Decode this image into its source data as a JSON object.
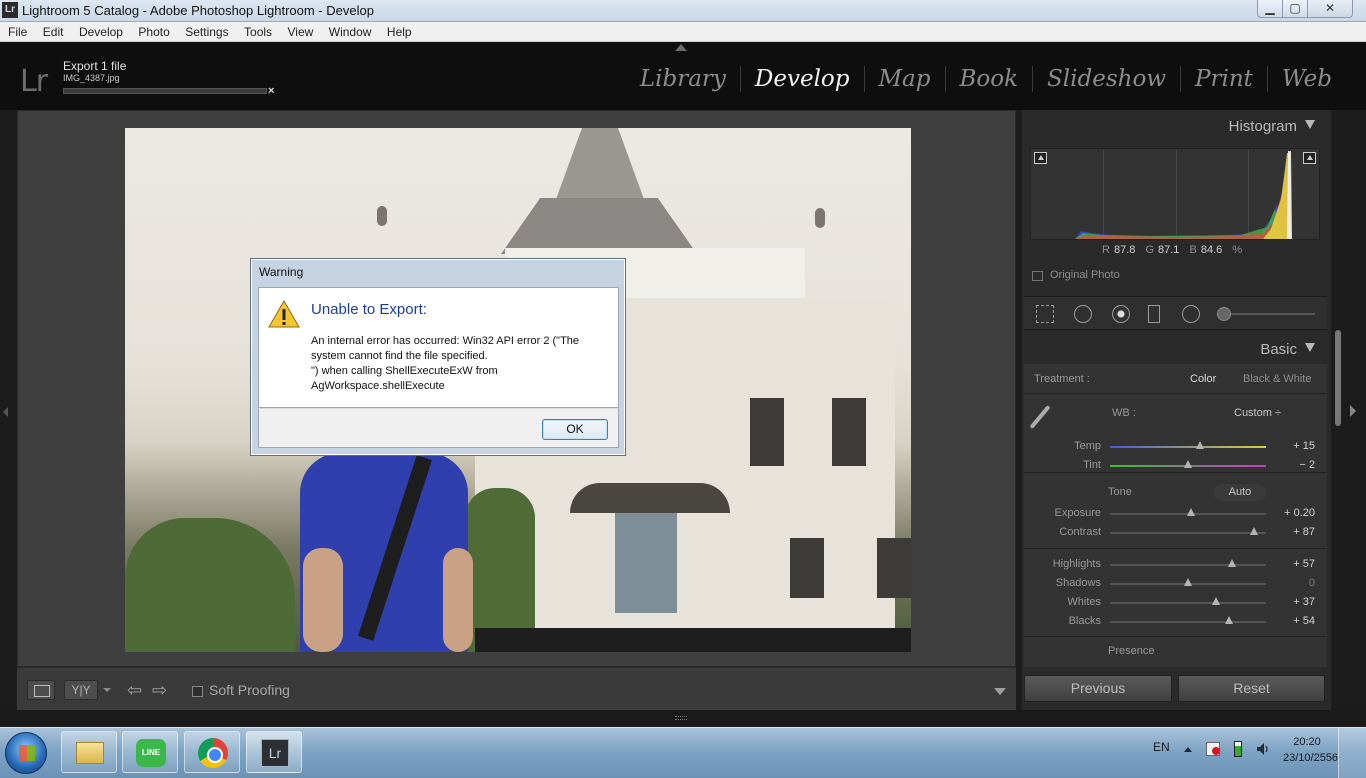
{
  "window": {
    "title": "Lightroom 5 Catalog - Adobe Photoshop Lightroom - Develop",
    "app_icon_text": "Lr",
    "minimize_glyph": "▁",
    "maximize_glyph": "▢",
    "close_glyph": "✕"
  },
  "menu": [
    "File",
    "Edit",
    "Develop",
    "Photo",
    "Settings",
    "Tools",
    "View",
    "Window",
    "Help"
  ],
  "header": {
    "logo": "Lr",
    "export_title": "Export 1 file",
    "export_filename": "IMG_4387.jpg",
    "export_cancel": "×",
    "modules": [
      "Library",
      "Develop",
      "Map",
      "Book",
      "Slideshow",
      "Print",
      "Web"
    ],
    "active_module": "Develop"
  },
  "toolbar": {
    "compare_label": "Y|Y",
    "prev_arrow": "⇦",
    "next_arrow": "⇨",
    "soft_proofing_label": "Soft Proofing",
    "soft_proofing_checked": false
  },
  "histogram": {
    "title": "Histogram",
    "r_label": "R",
    "r_value": "87.8",
    "g_label": "G",
    "g_value": "87.1",
    "b_label": "B",
    "b_value": "84.6",
    "percent": "%",
    "original_photo_label": "Original Photo",
    "original_photo_checked": false
  },
  "basic": {
    "title": "Basic",
    "treatment_label": "Treatment :",
    "treatment_color": "Color",
    "treatment_bw": "Black & White",
    "wb_label": "WB :",
    "wb_value": "Custom ÷",
    "tone_label": "Tone",
    "auto_label": "Auto",
    "presence_label": "Presence",
    "sliders": [
      {
        "label": "Temp",
        "value": "+ 15",
        "level": 0.58
      },
      {
        "label": "Tint",
        "value": "− 2",
        "level": 0.5
      },
      {
        "label": "Exposure",
        "value": "+ 0.20",
        "level": 0.52
      },
      {
        "label": "Contrast",
        "value": "+ 87",
        "level": 0.92
      },
      {
        "label": "Highlights",
        "value": "+ 57",
        "level": 0.78
      },
      {
        "label": "Shadows",
        "value": "0",
        "level": 0.5
      },
      {
        "label": "Whites",
        "value": "+ 37",
        "level": 0.68
      },
      {
        "label": "Blacks",
        "value": "+ 54",
        "level": 0.76
      }
    ]
  },
  "panel_buttons": {
    "previous": "Previous",
    "reset": "Reset"
  },
  "dialog": {
    "title": "Warning",
    "heading": "Unable to Export:",
    "message": "An internal error has occurred: Win32 API error 2 (\"The system cannot find the file specified.\n\") when calling ShellExecuteExW from AgWorkspace.shellExecute",
    "ok_label": "OK"
  },
  "taskbar": {
    "line_label": "LINE",
    "lr_label": "Lr",
    "language": "EN",
    "time": "20:20",
    "date": "23/10/2556"
  },
  "colors": {
    "accent_heading": "#1a3fa0",
    "panel_bg": "#2a2a2a",
    "active_module": "#f2f2f2"
  }
}
